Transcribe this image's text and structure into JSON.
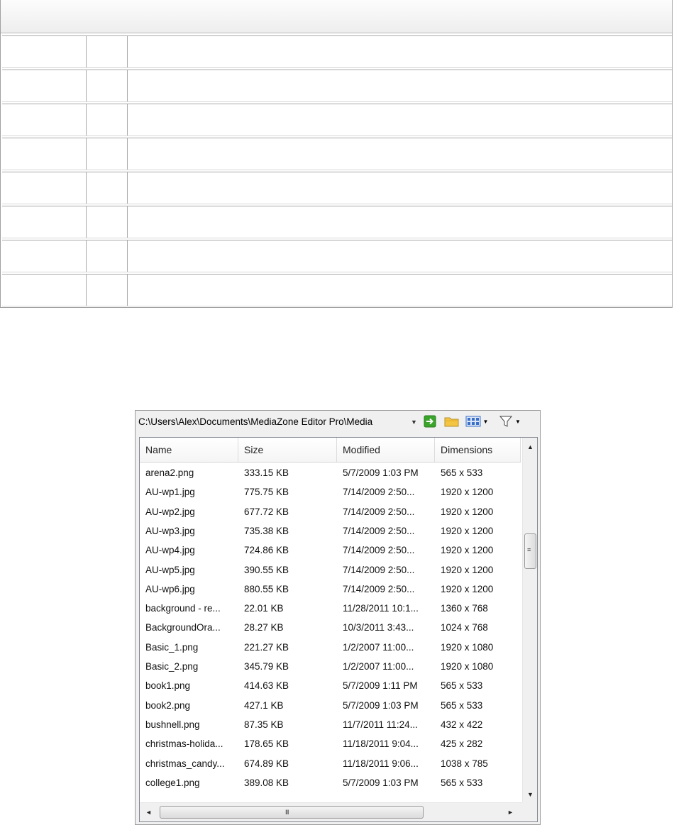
{
  "path_bar": {
    "path": "C:\\Users\\Alex\\Documents\\MediaZone Editor Pro\\Media"
  },
  "toolbar": {
    "go_icon": "green-arrow-icon",
    "folder_icon": "folder-icon",
    "view_icon": "view-mode-icon",
    "filter_icon": "filter-icon"
  },
  "columns": [
    "Name",
    "Size",
    "Modified",
    "Dimensions"
  ],
  "files": [
    {
      "name": "arena2.png",
      "size": "333.15 KB",
      "modified": "5/7/2009 1:03 PM",
      "dimensions": "565 x 533"
    },
    {
      "name": "AU-wp1.jpg",
      "size": "775.75 KB",
      "modified": "7/14/2009  2:50...",
      "dimensions": "1920 x 1200"
    },
    {
      "name": "AU-wp2.jpg",
      "size": "677.72 KB",
      "modified": "7/14/2009  2:50...",
      "dimensions": "1920 x 1200"
    },
    {
      "name": "AU-wp3.jpg",
      "size": "735.38 KB",
      "modified": "7/14/2009  2:50...",
      "dimensions": "1920 x 1200"
    },
    {
      "name": "AU-wp4.jpg",
      "size": "724.86 KB",
      "modified": "7/14/2009  2:50...",
      "dimensions": "1920 x 1200"
    },
    {
      "name": "AU-wp5.jpg",
      "size": "390.55 KB",
      "modified": "7/14/2009  2:50...",
      "dimensions": "1920 x 1200"
    },
    {
      "name": "AU-wp6.jpg",
      "size": "880.55 KB",
      "modified": "7/14/2009  2:50...",
      "dimensions": "1920 x 1200"
    },
    {
      "name": "background - re...",
      "size": "22.01 KB",
      "modified": "11/28/2011  10:1...",
      "dimensions": "1360 x 768"
    },
    {
      "name": "BackgroundOra...",
      "size": "28.27 KB",
      "modified": "10/3/2011  3:43...",
      "dimensions": "1024 x 768"
    },
    {
      "name": "Basic_1.png",
      "size": "221.27 KB",
      "modified": "1/2/2007  11:00...",
      "dimensions": "1920 x 1080"
    },
    {
      "name": "Basic_2.png",
      "size": "345.79 KB",
      "modified": "1/2/2007  11:00...",
      "dimensions": "1920 x 1080"
    },
    {
      "name": "book1.png",
      "size": "414.63 KB",
      "modified": "5/7/2009 1:11 PM",
      "dimensions": "565 x 533"
    },
    {
      "name": "book2.png",
      "size": "427.1 KB",
      "modified": "5/7/2009 1:03 PM",
      "dimensions": "565 x 533"
    },
    {
      "name": "bushnell.png",
      "size": "87.35 KB",
      "modified": "11/7/2011  11:24...",
      "dimensions": "432 x 422"
    },
    {
      "name": "christmas-holida...",
      "size": "178.65 KB",
      "modified": "11/18/2011  9:04...",
      "dimensions": "425 x 282"
    },
    {
      "name": "christmas_candy...",
      "size": "674.89 KB",
      "modified": "11/18/2011  9:06...",
      "dimensions": "1038 x 785"
    },
    {
      "name": "college1.png",
      "size": "389.08 KB",
      "modified": "5/7/2009 1:03 PM",
      "dimensions": "565 x 533"
    }
  ],
  "scroll": {
    "vertical_grip": "≡",
    "horizontal_grip": "III",
    "up_arrow": "▲",
    "down_arrow": "▼",
    "left_arrow": "◄",
    "right_arrow": "►"
  },
  "colors": {
    "accent_green": "#3aa52b",
    "folder_yellow": "#f4c542",
    "view_blue": "#3b6fc7"
  }
}
